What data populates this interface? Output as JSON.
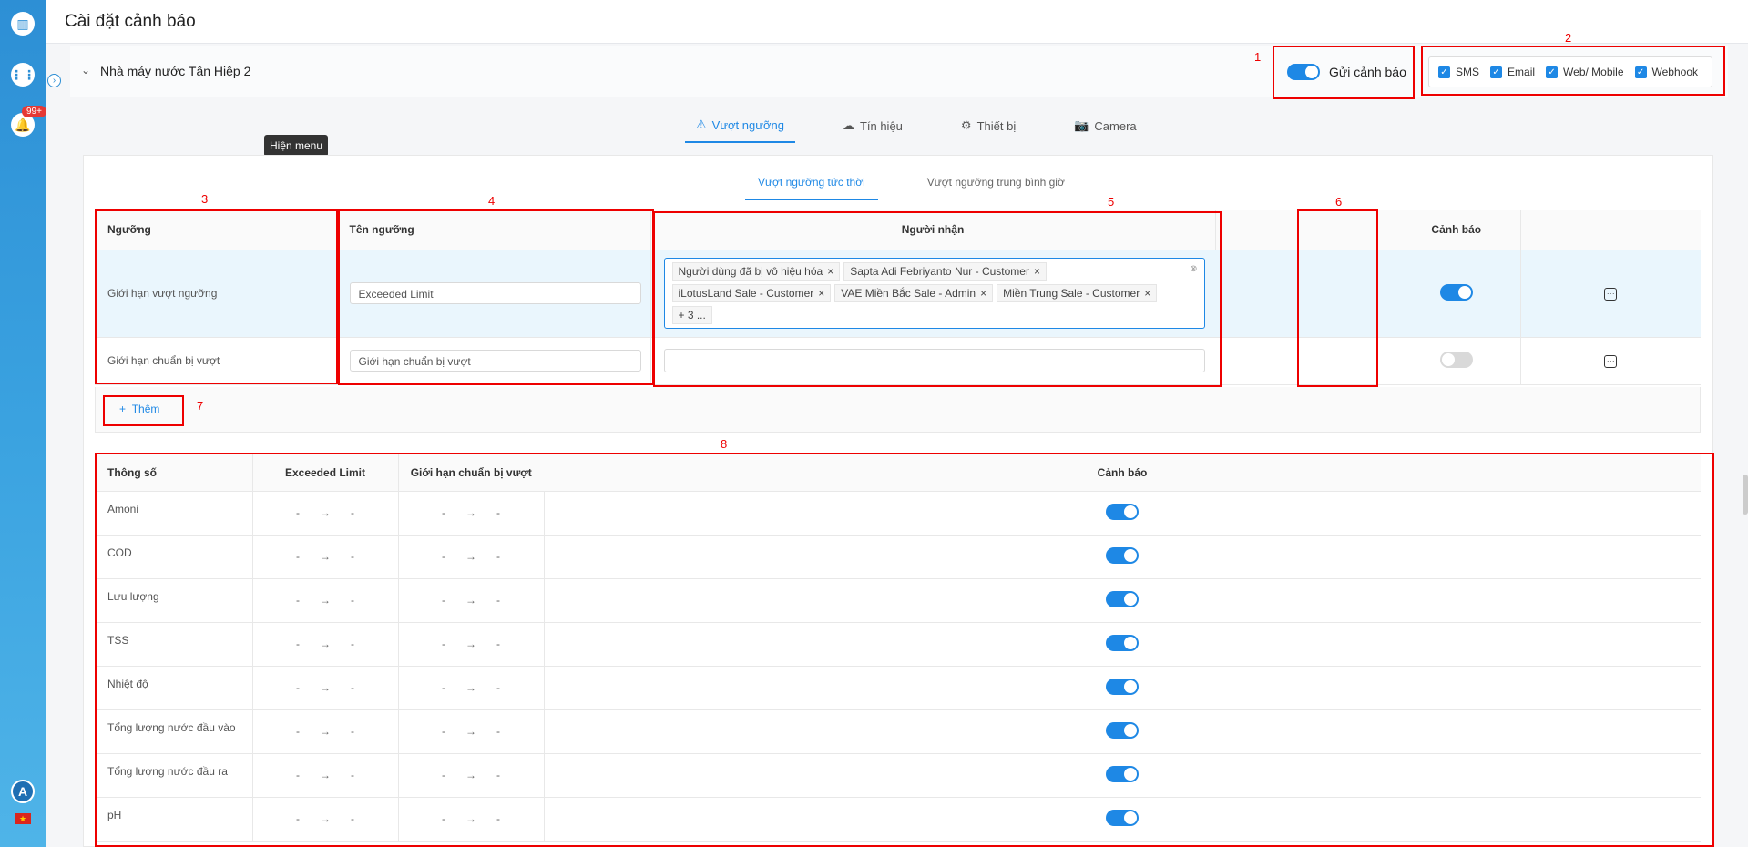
{
  "header": {
    "title": "Cài đặt cảnh báo"
  },
  "sidebar": {
    "badge": "99+",
    "avatar": "A",
    "flag": "★"
  },
  "station": {
    "name": "Nhà máy nước Tân Hiệp 2",
    "send_alert_label": "Gửi cảnh báo",
    "send_alert_on": true
  },
  "channels": [
    {
      "label": "SMS",
      "checked": true
    },
    {
      "label": "Email",
      "checked": true
    },
    {
      "label": "Web/ Mobile",
      "checked": true
    },
    {
      "label": "Webhook",
      "checked": true
    }
  ],
  "tabs": [
    {
      "label": "Vượt ngưỡng",
      "icon": "warning-icon",
      "active": true
    },
    {
      "label": "Tín hiệu",
      "icon": "cloud-icon",
      "active": false
    },
    {
      "label": "Thiết bị",
      "icon": "gear-icon",
      "active": false
    },
    {
      "label": "Camera",
      "icon": "camera-icon",
      "active": false
    }
  ],
  "tooltip": "Hiện menu",
  "subtabs": [
    {
      "label": "Vượt ngưỡng tức thời",
      "active": true
    },
    {
      "label": "Vượt ngưỡng trung bình giờ",
      "active": false
    }
  ],
  "threshold_table": {
    "headers": {
      "threshold": "Ngưỡng",
      "name": "Tên ngưỡng",
      "recipients": "Người nhận",
      "alert": "Cảnh báo"
    },
    "rows": [
      {
        "threshold": "Giới hạn vượt ngưỡng",
        "name_placeholder": "Exceeded Limit",
        "recipients": [
          "Người dùng đã bị vô hiệu hóa",
          "Sapta Adi Febriyanto Nur - Customer",
          "iLotusLand Sale - Customer",
          "VAE Miền Bắc Sale - Admin",
          "Miền Trung Sale - Customer"
        ],
        "more": "+ 3 ...",
        "alert_on": true
      },
      {
        "threshold": "Giới hạn chuẩn bị vượt",
        "name_placeholder": "Giới hạn chuẩn bị vượt",
        "recipients": [],
        "more": "",
        "alert_on": false
      }
    ],
    "add_label": "Thêm"
  },
  "params_table": {
    "headers": {
      "param": "Thông số",
      "limit1": "Exceeded Limit",
      "limit2": "Giới hạn chuẩn bị vượt",
      "alert": "Cảnh báo"
    },
    "rows": [
      {
        "param": "Amoni",
        "min1": "-",
        "max1": "-",
        "min2": "-",
        "max2": "-",
        "alert_on": true
      },
      {
        "param": "COD",
        "min1": "-",
        "max1": "-",
        "min2": "-",
        "max2": "-",
        "alert_on": true
      },
      {
        "param": "Lưu lượng",
        "min1": "-",
        "max1": "-",
        "min2": "-",
        "max2": "-",
        "alert_on": true
      },
      {
        "param": "TSS",
        "min1": "-",
        "max1": "-",
        "min2": "-",
        "max2": "-",
        "alert_on": true
      },
      {
        "param": "Nhiệt độ",
        "min1": "-",
        "max1": "-",
        "min2": "-",
        "max2": "-",
        "alert_on": true
      },
      {
        "param": "Tổng lượng nước đầu vào",
        "min1": "-",
        "max1": "-",
        "min2": "-",
        "max2": "-",
        "alert_on": true
      },
      {
        "param": "Tổng lượng nước đầu ra",
        "min1": "-",
        "max1": "-",
        "min2": "-",
        "max2": "-",
        "alert_on": true
      },
      {
        "param": "pH",
        "min1": "-",
        "max1": "-",
        "min2": "-",
        "max2": "-",
        "alert_on": true
      }
    ]
  },
  "annotations": [
    "1",
    "2",
    "3",
    "4",
    "5",
    "6",
    "7",
    "8"
  ],
  "colors": {
    "accent": "#1e88e5",
    "annotation": "#e00000",
    "sidebar": "#2d8fd5"
  }
}
